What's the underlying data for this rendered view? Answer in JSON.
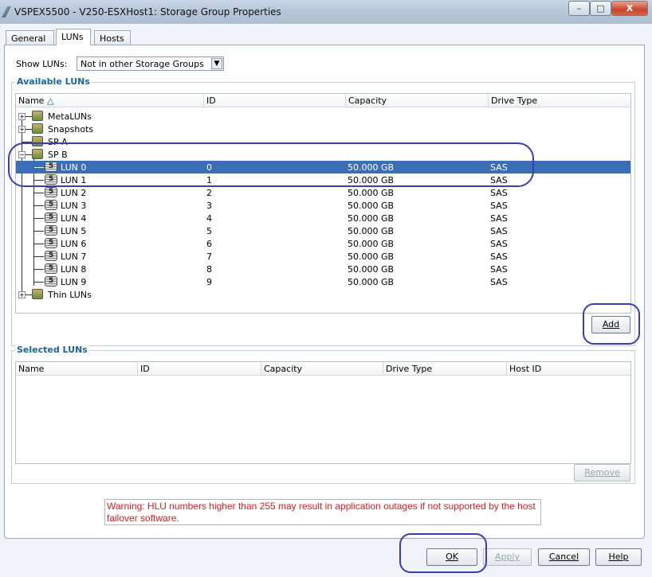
{
  "window": {
    "title": "VSPEX5500 - V250-ESXHost1: Storage Group Properties",
    "minimize": "–",
    "maximize": "□",
    "close": "X"
  },
  "tabs": [
    {
      "label": "General"
    },
    {
      "label": "LUNs"
    },
    {
      "label": "Hosts"
    }
  ],
  "show_luns": {
    "label": "Show LUNs:",
    "value": "Not in other Storage Groups"
  },
  "available": {
    "legend": "Available LUNs",
    "columns": [
      "Name",
      "ID",
      "Capacity",
      "Drive Type"
    ],
    "sort_icon": "sort-ascending-icon",
    "tree": [
      {
        "name": "MetaLUNs",
        "icon": "metalun-icon",
        "expander": "+"
      },
      {
        "name": "Snapshots",
        "icon": "snapshot-icon",
        "expander": "+"
      },
      {
        "name": "SP A",
        "icon": "storage-processor-icon",
        "expander": ""
      },
      {
        "name": "SP B",
        "icon": "storage-processor-icon",
        "expander": "−"
      },
      {
        "name": "Thin LUNs",
        "icon": "thin-lun-icon",
        "expander": "+"
      }
    ],
    "luns": [
      {
        "name": "LUN 0",
        "id": "0",
        "capacity": "50.000 GB",
        "drive": "SAS",
        "selected": true
      },
      {
        "name": "LUN 1",
        "id": "1",
        "capacity": "50.000 GB",
        "drive": "SAS"
      },
      {
        "name": "LUN 2",
        "id": "2",
        "capacity": "50.000 GB",
        "drive": "SAS"
      },
      {
        "name": "LUN 3",
        "id": "3",
        "capacity": "50.000 GB",
        "drive": "SAS"
      },
      {
        "name": "LUN 4",
        "id": "4",
        "capacity": "50.000 GB",
        "drive": "SAS"
      },
      {
        "name": "LUN 5",
        "id": "5",
        "capacity": "50.000 GB",
        "drive": "SAS"
      },
      {
        "name": "LUN 6",
        "id": "6",
        "capacity": "50.000 GB",
        "drive": "SAS"
      },
      {
        "name": "LUN 7",
        "id": "7",
        "capacity": "50.000 GB",
        "drive": "SAS"
      },
      {
        "name": "LUN 8",
        "id": "8",
        "capacity": "50.000 GB",
        "drive": "SAS"
      },
      {
        "name": "LUN 9",
        "id": "9",
        "capacity": "50.000 GB",
        "drive": "SAS"
      }
    ],
    "add_label": "Add"
  },
  "selected": {
    "legend": "Selected LUNs",
    "columns": [
      "Name",
      "ID",
      "Capacity",
      "Drive Type",
      "Host ID"
    ],
    "remove_label": "Remove"
  },
  "warning": "Warning: HLU numbers higher than 255 may result in application outages if not supported by the host failover software.",
  "buttons": {
    "ok": "OK",
    "apply": "Apply",
    "cancel": "Cancel",
    "help": "Help"
  },
  "colors": {
    "selection": "#3a6fb8",
    "warning": "#d81e1e",
    "legend": "#1a6496",
    "annotation": "#3a3fb0"
  }
}
